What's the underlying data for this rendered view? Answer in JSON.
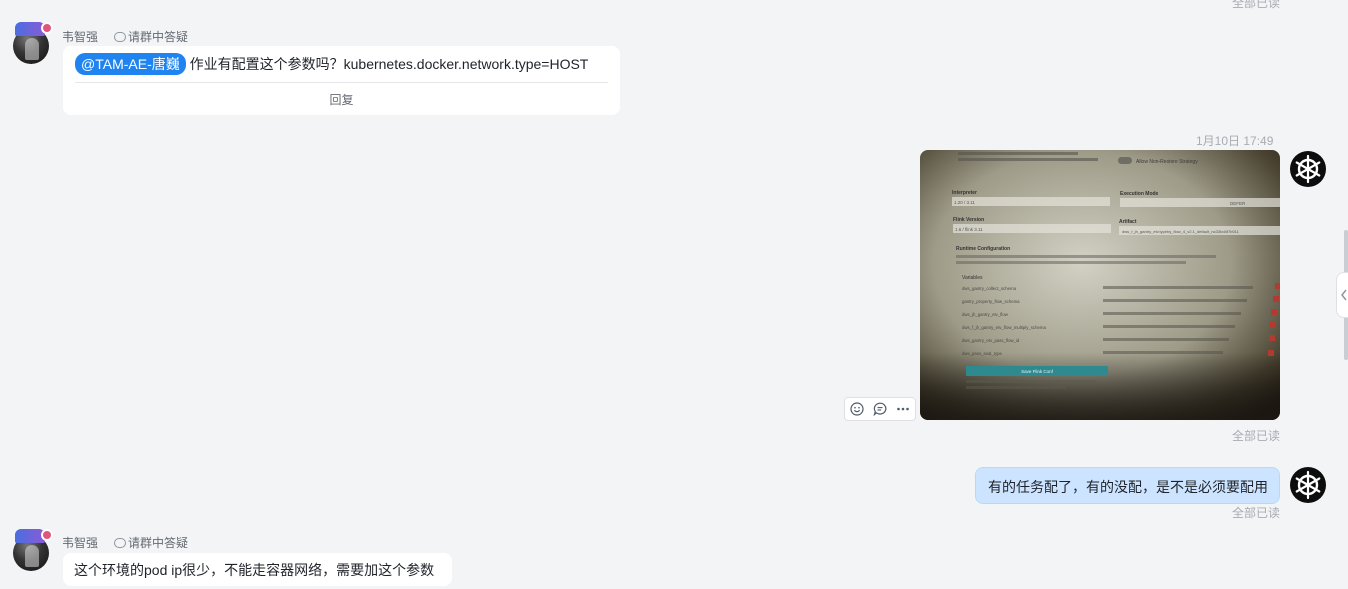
{
  "top_read_status": "全部已读",
  "msg1": {
    "sender": "韦智强",
    "group_tag": "请群中答疑",
    "mention": "@TAM-AE-唐巍",
    "text": "作业有配置这个参数吗？kubernetes.docker.network.type=HOST",
    "reply_label": "回复"
  },
  "msg2": {
    "timestamp": "1月10日 17:49",
    "read_status": "全部已读"
  },
  "msg3": {
    "text": "有的任务配了，有的没配，是不是必须要配用",
    "read_status": "全部已读"
  },
  "msg4": {
    "sender": "韦智强",
    "group_tag": "请群中答疑",
    "text": "这个环境的pod ip很少，不能走容器网络，需要加这个参数"
  },
  "photo_content": {
    "header_note": "Allow Non-Restore Strategy",
    "interpreter_label": "Interpreter",
    "interpreter_value": "1.20 / 3.11",
    "execution_mode_label": "Execution Mode",
    "execution_mode_value": "DEFER",
    "flink_version_label": "Flink Version",
    "flink_version_value": "1.6 / flink 3.11",
    "artifact_label": "Artifact",
    "artifact_value": "dws_f_jh_gantry_etv.typeby_flow_4_v2.1_default_no33bd4f7b011",
    "runtime_config_label": "Runtime Configuration",
    "variables_label": "Variables",
    "variables": [
      "dws_gantry_collect_schema",
      "gantry_property_flow_schema",
      "dws_jh_gantry_etv_flow",
      "dws_f_jh_gantry_etv_flow_multiply_schema",
      "dws_gantry_etv_pass_flow_id",
      "dws_pass_seal_type"
    ],
    "button_label": "Save Flink Conf"
  },
  "icons": {
    "emoji": "emoji-icon",
    "reply": "reply-icon",
    "more": "more-icon",
    "k8s": "kubernetes-helm-icon",
    "collapse": "chevron-left-icon"
  },
  "colors": {
    "mention_bg": "#1f84f0",
    "bubble_self": "#cce4ff",
    "background": "#f3f4f6"
  }
}
